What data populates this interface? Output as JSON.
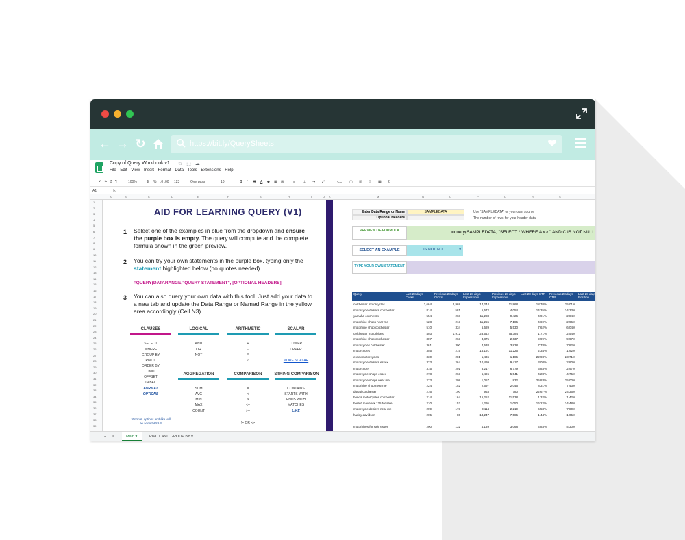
{
  "browser": {
    "url": "https://bit.ly/QuerySheets"
  },
  "sheet": {
    "title": "Copy of Query Workbook v1",
    "menu": [
      "File",
      "Edit",
      "View",
      "Insert",
      "Format",
      "Data",
      "Tools",
      "Extensions",
      "Help"
    ],
    "toolbar": {
      "zoom": "100%",
      "currency": "$",
      "percent": "%",
      "decimals": ".0 .00",
      "format": "123",
      "font": "Overpass",
      "size": "10",
      "bold": "B",
      "italic": "I",
      "strike": "S",
      "textcolor": "A"
    },
    "cellref": "A1",
    "fx": "fx",
    "columns": [
      "A",
      "B",
      "C",
      "D",
      "E",
      "F",
      "G",
      "H",
      "I",
      "J",
      "K",
      "L",
      "M",
      "N",
      "O",
      "P",
      "Q",
      "R",
      "S",
      "T"
    ],
    "rows": [
      "1",
      "2",
      "3",
      "4",
      "5",
      "6",
      "7",
      "8",
      "9",
      "10",
      "11",
      "12",
      "13",
      "14",
      "15",
      "16",
      "17",
      "18",
      "19",
      "20",
      "21",
      "22",
      "23",
      "24",
      "25",
      "26",
      "27",
      "28",
      "29",
      "30",
      "31",
      "32",
      "33",
      "34",
      "35",
      "36",
      "37",
      "38",
      "39"
    ]
  },
  "left": {
    "title": "AID FOR LEARNING QUERY (V1)",
    "steps": [
      {
        "num": "1",
        "pre": "Select one of the examples in blue from the dropdown and ",
        "bold": "ensure the purple box is empty.",
        "post": " The query will compute and the complete formula shown in the green preview."
      },
      {
        "num": "2",
        "pre": "You can try your own statements in the purple box, typing only the ",
        "hl": "statement",
        "post": " highlighted below (no quotes needed)"
      },
      {
        "num": "3",
        "text": "You can also query your own data with this tool. Just add your data to a new tab and update the Data Range or Named Range in the yellow area accordingly (Cell N3)"
      }
    ],
    "formula_example": "=QUERY(DATARANGE,\"QUERY STATEMENT\", [OPTIONAL HEADERS]",
    "sections": {
      "clauses": {
        "title": "CLAUSES",
        "items": [
          "SELECT",
          "WHERE",
          "GROUP BY",
          "PIVOT",
          "ORDER BY",
          "LIMIT",
          "OFFSET",
          "LABEL",
          "FORMAT",
          "OPTIONS"
        ]
      },
      "logical": {
        "title": "LOGICAL",
        "items": [
          "AND",
          "OR",
          "NOT"
        ]
      },
      "arithmetic": {
        "title": "ARITHMETIC",
        "items": [
          "+",
          "-",
          "*",
          "/"
        ]
      },
      "scalar": {
        "title": "SCALAR",
        "items": [
          "LOWER",
          "UPPER"
        ],
        "link": "MORE SCALAR"
      },
      "aggregation": {
        "title": "AGGREGATION",
        "items": [
          "SUM",
          "AVG",
          "MIN",
          "MAX",
          "COUNT"
        ]
      },
      "comparison": {
        "title": "COMPARISON",
        "items": [
          "=",
          "<",
          ">",
          "<=",
          ">=",
          "!= OR <>"
        ]
      },
      "string_comparison": {
        "title": "STRING COMPARISON",
        "items": [
          "CONTAINS",
          "STARTS WITH",
          "ENDS WITH",
          "MATCHES",
          "LIKE"
        ]
      }
    },
    "note": "*Format, options and like will be added ASAP."
  },
  "right": {
    "data_range_label": "Enter Data Range or Name",
    "data_range_value": "SAMPLEDATA",
    "data_range_hint": "Use 'SAMPLEDATA' or your own source",
    "headers_label": "Optional Headers",
    "headers_hint": "The number of rows for your header data",
    "preview_label": "PREVIEW OF FORMULA",
    "preview_value": "=query(SAMPLEDATA, \"SELECT * WHERE A <> '' AND C IS NOT NULL\")",
    "example_label": "SELECT AN EXAMPLE",
    "example_value": "IS NOT NULL",
    "own_label": "TYPE YOUR OWN STATEMENT",
    "table_headers": [
      "Query",
      "Last 28 days Clicks",
      "Previous 28 days Clicks",
      "Last 28 days Impressions",
      "Previous 28 days Impressions",
      "Last 28 days CTR",
      "Previous 28 days CTR",
      "Last 28 days Position"
    ],
    "table_rows": [
      [
        "colchester motorcycles",
        "2,664",
        "2,968",
        "14,244",
        "11,868",
        "18.70%",
        "25.01%"
      ],
      [
        "motorcycle dealers colchester",
        "814",
        "581",
        "5,672",
        "4,054",
        "14.35%",
        "14.33%"
      ],
      [
        "yamaha colchester",
        "554",
        "268",
        "11,288",
        "9,426",
        "4.91%",
        "2.84%"
      ],
      [
        "motorbike shops near me",
        "528",
        "213",
        "11,255",
        "7,185",
        "4.69%",
        "2.96%"
      ],
      [
        "motorbike shop colchester",
        "510",
        "334",
        "6,689",
        "5,530",
        "7.62%",
        "6.04%"
      ],
      [
        "colchester motorbikes",
        "403",
        "1,912",
        "23,542",
        "75,384",
        "1.71%",
        "2.54%"
      ],
      [
        "motorbike shop colchester",
        "387",
        "263",
        "3,875",
        "2,637",
        "9.99%",
        "9.97%"
      ],
      [
        "motorcycles colchester",
        "361",
        "300",
        "4,638",
        "3,838",
        "7.78%",
        "7.82%"
      ],
      [
        "motorcycles",
        "355",
        "215",
        "15,191",
        "11,225",
        "2.34%",
        "1.92%"
      ],
      [
        "essex motorcycles",
        "330",
        "281",
        "1,436",
        "1,185",
        "22.98%",
        "23.71%"
      ],
      [
        "motorcycle dealers essex",
        "323",
        "264",
        "10,499",
        "9,417",
        "3.08%",
        "2.80%"
      ],
      [
        "motorcycle",
        "315",
        "201",
        "8,217",
        "6,779",
        "3.83%",
        "2.97%"
      ],
      [
        "motorcycle shops essex",
        "278",
        "263",
        "6,496",
        "5,541",
        "4.28%",
        "4.75%"
      ],
      [
        "motorcycle shops near me",
        "273",
        "208",
        "1,057",
        "832",
        "25.83%",
        "25.00%"
      ],
      [
        "motorbike shop near me",
        "224",
        "152",
        "2,697",
        "2,046",
        "8.31%",
        "7.43%"
      ],
      [
        "ducati colchester",
        "216",
        "190",
        "953",
        "780",
        "22.67%",
        "24.36%"
      ],
      [
        "honda motorcycles colchester",
        "214",
        "164",
        "16,252",
        "11,538",
        "1.32%",
        "1.42%"
      ],
      [
        "herald maverick 125 for sale",
        "210",
        "152",
        "1,295",
        "1,050",
        "16.22%",
        "14.48%"
      ],
      [
        "motorcycle dealers near me",
        "209",
        "173",
        "3,114",
        "2,219",
        "6.58%",
        "7.80%"
      ],
      [
        "harley davidson",
        "205",
        "80",
        "14,247",
        "7,585",
        "1.44%",
        "1.05%"
      ],
      [
        "",
        "",
        "",
        "",
        "",
        "",
        ""
      ],
      [
        "motorbikes for sale essex",
        "200",
        "132",
        "4,139",
        "3,068",
        "4.83%",
        "4.30%"
      ]
    ]
  },
  "tabs": {
    "add": "+",
    "list": "≡",
    "main": "Main ▾",
    "pivot": "PIVOT AND GROUP BY ▾"
  },
  "colors": {
    "titlebar": "#263535",
    "navbar": "#c1ebe3",
    "divider": "#2f1a6e",
    "table_header": "#1f4f8f",
    "title": "#2c2a6b"
  }
}
